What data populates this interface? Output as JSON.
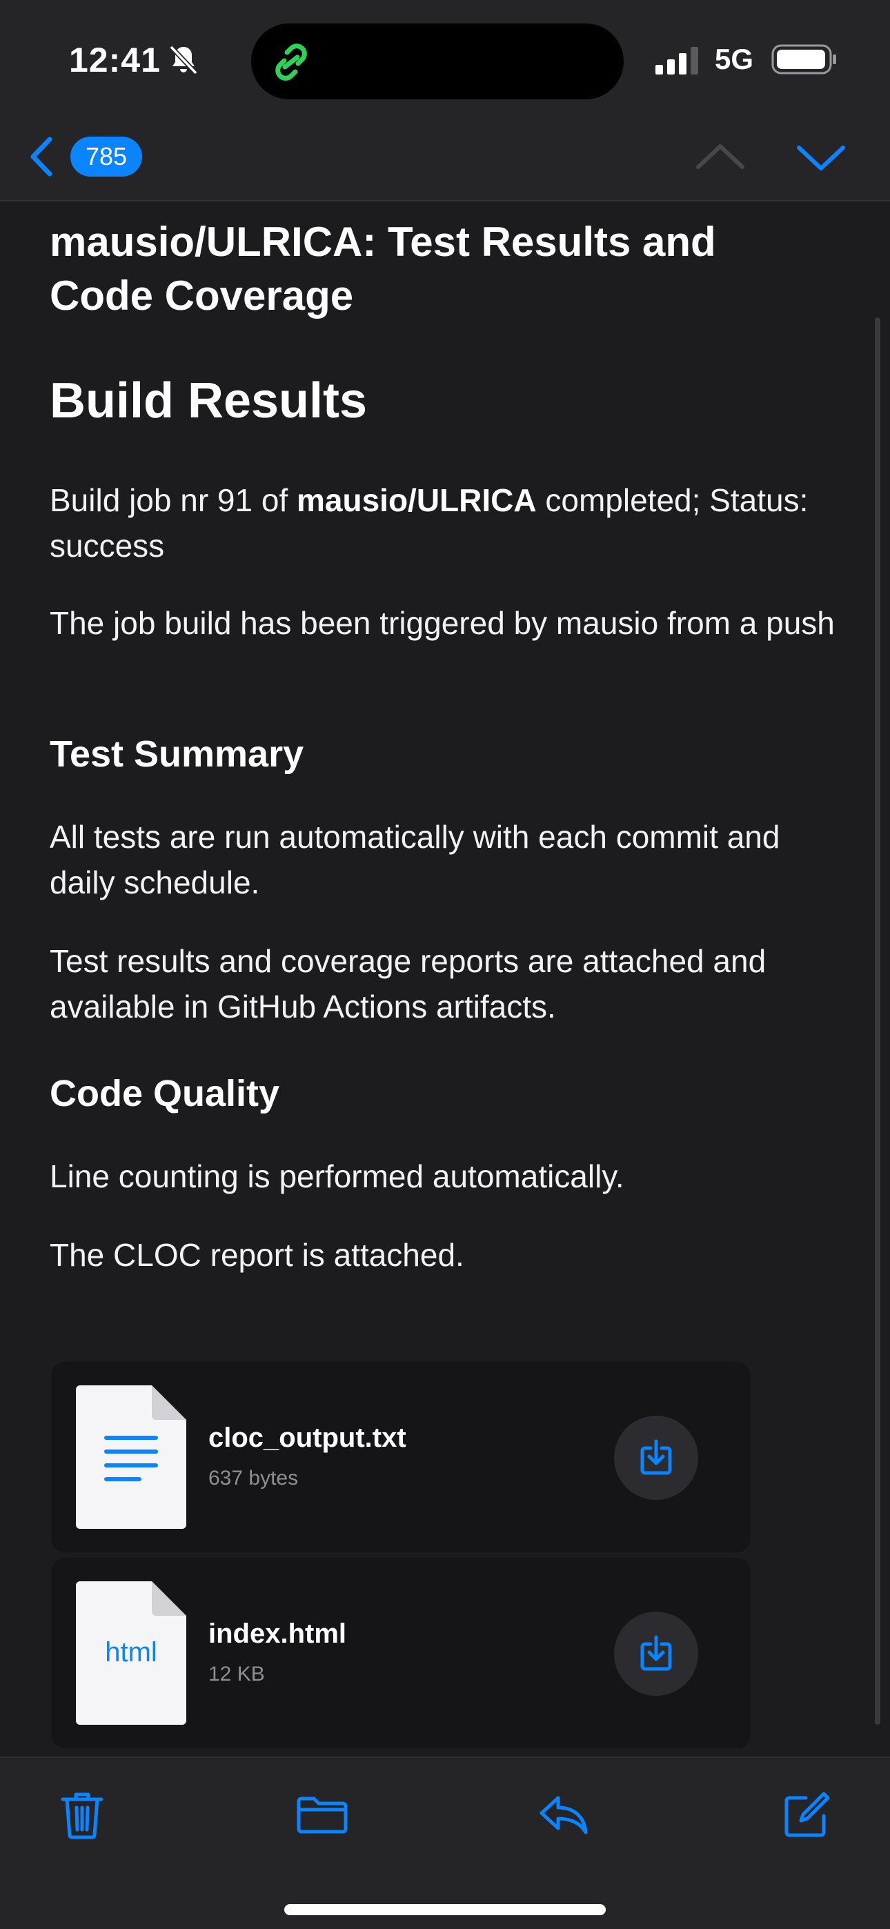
{
  "status_bar": {
    "time": "12:41",
    "network": "5G",
    "icons": [
      "bell-slash-icon",
      "link-icon",
      "signal-icon",
      "battery-icon"
    ]
  },
  "nav": {
    "message_count": "785",
    "icons": [
      "chevron-left-icon",
      "chevron-up-icon",
      "chevron-down-icon"
    ]
  },
  "message": {
    "subject": "mausio/ULRICA: Test Results and Code Coverage",
    "heading": "Build Results",
    "build_prefix": "Build job nr 91 of ",
    "build_repo": "mausio/ULRICA",
    "build_suffix": " completed; Status: success",
    "trigger_text": "The job build has been triggered by mausio from a push",
    "test_summary_heading": "Test Summary",
    "test_summary_text": "All tests are run automatically with each commit and daily schedule.",
    "test_results_text": "Test results and coverage reports are attached and available in GitHub Actions artifacts.",
    "code_quality_heading": "Code Quality",
    "line_count_text": "Line counting is performed automatically.",
    "cloc_text": "The CLOC report is attached."
  },
  "attachments": [
    {
      "name": "cloc_output.txt",
      "size": "637 bytes",
      "icon": "text-file-icon"
    },
    {
      "name": "index.html",
      "size": "12 KB",
      "icon": "html-file-icon",
      "thumb_label": "html"
    }
  ],
  "toolbar": {
    "icons": [
      "trash-icon",
      "folder-icon",
      "reply-icon",
      "compose-icon"
    ]
  },
  "colors": {
    "accent": "#0a84ff",
    "background": "#1c1c1e",
    "chrome": "#252527",
    "link_green": "#30d158"
  }
}
